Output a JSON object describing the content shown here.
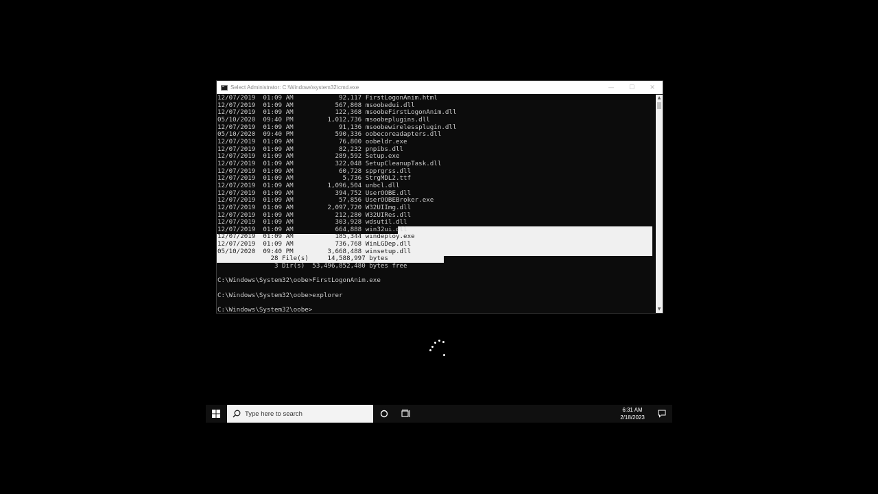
{
  "window": {
    "title": "Select Administrator: C:\\Windows\\system32\\cmd.exe",
    "controls": {
      "minimize": "—",
      "maximize": "☐",
      "close": "✕"
    }
  },
  "console": {
    "listing": [
      {
        "date": "12/07/2019",
        "time": "01:09 AM",
        "size": "92,117",
        "name": "FirstLogonAnim.html"
      },
      {
        "date": "12/07/2019",
        "time": "01:09 AM",
        "size": "567,808",
        "name": "msoobedui.dll"
      },
      {
        "date": "12/07/2019",
        "time": "01:09 AM",
        "size": "122,368",
        "name": "msoobeFirstLogonAnim.dll"
      },
      {
        "date": "05/10/2020",
        "time": "09:40 PM",
        "size": "1,012,736",
        "name": "msoobeplugins.dll"
      },
      {
        "date": "12/07/2019",
        "time": "01:09 AM",
        "size": "91,136",
        "name": "msoobewirelessplugin.dll"
      },
      {
        "date": "05/10/2020",
        "time": "09:40 PM",
        "size": "590,336",
        "name": "oobecoreadapters.dll"
      },
      {
        "date": "12/07/2019",
        "time": "01:09 AM",
        "size": "76,800",
        "name": "oobeldr.exe"
      },
      {
        "date": "12/07/2019",
        "time": "01:09 AM",
        "size": "82,232",
        "name": "pnpibs.dll"
      },
      {
        "date": "12/07/2019",
        "time": "01:09 AM",
        "size": "289,592",
        "name": "Setup.exe"
      },
      {
        "date": "12/07/2019",
        "time": "01:09 AM",
        "size": "322,048",
        "name": "SetupCleanupTask.dll"
      },
      {
        "date": "12/07/2019",
        "time": "01:09 AM",
        "size": "60,728",
        "name": "spprgrss.dll"
      },
      {
        "date": "12/07/2019",
        "time": "01:09 AM",
        "size": "5,736",
        "name": "StrgMDL2.ttf"
      },
      {
        "date": "12/07/2019",
        "time": "01:09 AM",
        "size": "1,096,504",
        "name": "unbcl.dll"
      },
      {
        "date": "12/07/2019",
        "time": "01:09 AM",
        "size": "394,752",
        "name": "UserOOBE.dll"
      },
      {
        "date": "12/07/2019",
        "time": "01:09 AM",
        "size": "57,856",
        "name": "UserOOBEBroker.exe"
      },
      {
        "date": "12/07/2019",
        "time": "01:09 AM",
        "size": "2,097,720",
        "name": "W32UIImg.dll"
      },
      {
        "date": "12/07/2019",
        "time": "01:09 AM",
        "size": "212,280",
        "name": "W32UIRes.dll"
      },
      {
        "date": "12/07/2019",
        "time": "01:09 AM",
        "size": "303,928",
        "name": "wdsutil.dll"
      },
      {
        "date": "12/07/2019",
        "time": "01:09 AM",
        "size": "664,888",
        "name": "win32ui.dll"
      },
      {
        "date": "12/07/2019",
        "time": "01:09 AM",
        "size": "185,344",
        "name": "windeploy.exe"
      },
      {
        "date": "12/07/2019",
        "time": "01:09 AM",
        "size": "736,768",
        "name": "WinLGDep.dll"
      },
      {
        "date": "05/10/2020",
        "time": "09:40 PM",
        "size": "3,668,488",
        "name": "winsetup.dll"
      }
    ],
    "summary_files": "              28 File(s)     14,588,997 bytes",
    "summary_dirs": "               3 Dir(s)  53,496,852,480 bytes free",
    "commands": [
      "C:\\Windows\\System32\\oobe>FirstLogonAnim.exe",
      "C:\\Windows\\System32\\oobe>explorer",
      "C:\\Windows\\System32\\oobe>"
    ]
  },
  "taskbar": {
    "search_placeholder": "Type here to search",
    "time": "6:31 AM",
    "date": "2/18/2023"
  },
  "colors": {
    "console_bg": "#0c0c0c",
    "console_text": "#cccccc",
    "selection": "#f0f0f0",
    "taskbar_bg": "#101010"
  }
}
